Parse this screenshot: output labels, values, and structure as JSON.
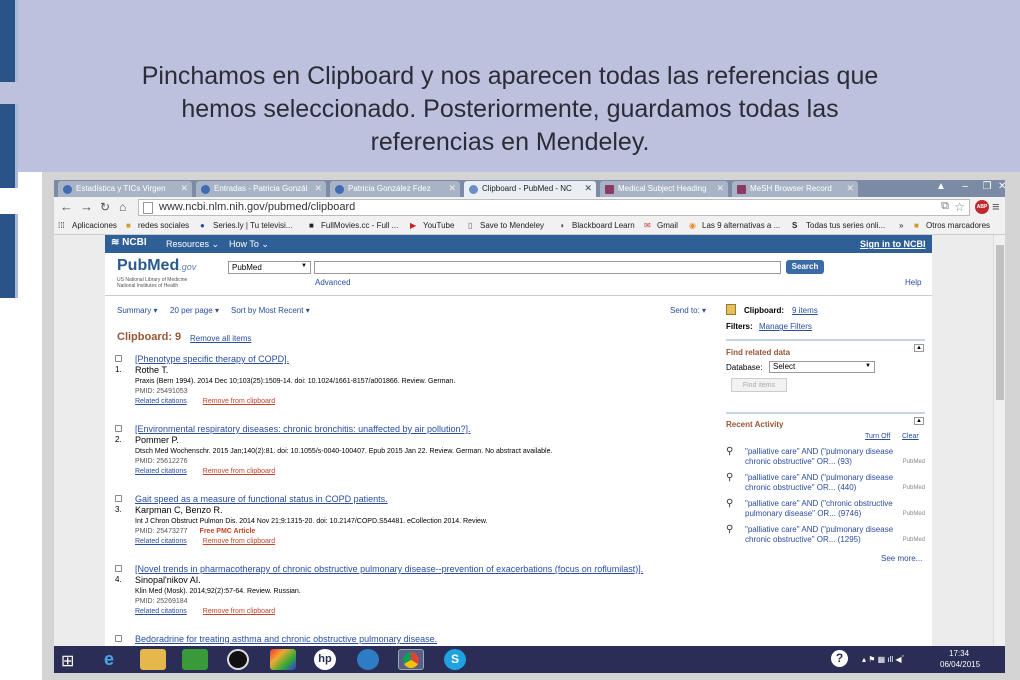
{
  "slide": {
    "caption_lines": [
      "Pinchamos en Clipboard y nos aparecen todas las referencias que",
      "hemos seleccionado. Posteriormente, guardamos todas las",
      "referencias en Mendeley."
    ]
  },
  "browser": {
    "tabs": [
      {
        "label": "Estadística y TICs Virgen",
        "active": false
      },
      {
        "label": "Entradas - Patricia Gonzál",
        "active": false
      },
      {
        "label": "Patricia González Fdez",
        "active": false
      },
      {
        "label": "Clipboard - PubMed - NC",
        "active": true
      },
      {
        "label": "Medical Subject Heading",
        "active": false
      },
      {
        "label": "MeSH Browser Record",
        "active": false
      }
    ],
    "url": "www.ncbi.nlm.nih.gov/pubmed/clipboard",
    "bookmarks": [
      "Aplicaciones",
      "redes sociales",
      "Series.ly | Tu televisi...",
      "FullMovies.cc - Full ...",
      "YouTube",
      "Save to Mendeley",
      "Blackboard Learn",
      "Gmail",
      "Las 9 alternativas a ...",
      "Todas tus series onli...",
      "Otros marcadores"
    ],
    "more_bookmarks": "»"
  },
  "ncbi_bar": {
    "logo": "NCBI",
    "resources": "Resources",
    "howto": "How To",
    "signin": "Sign in to NCBI"
  },
  "search": {
    "logo_main": "PubMed",
    "logo_gov": ".gov",
    "logo_sub": "US National Library of Medicine National Institutes of Health",
    "database": "PubMed",
    "query": "",
    "search_button": "Search",
    "advanced": "Advanced",
    "help": "Help"
  },
  "toolbar": {
    "summary": "Summary",
    "per_page": "20 per page",
    "sort": "Sort by Most Recent",
    "send_to": "Send to:"
  },
  "clipboard": {
    "heading": "Clipboard: 9",
    "remove_all": "Remove all items",
    "results": [
      {
        "num": "1.",
        "title": "[Phenotype specific therapy of COPD].",
        "authors": "Rothe T.",
        "citation": "Praxis (Bern 1994). 2014 Dec 10;103(25):1509-14. doi: 10.1024/1661-8157/a001866. Review. German.",
        "pmid": "PMID: 25491053",
        "free": "",
        "related": "Related citations",
        "remove": "Remove from clipboard"
      },
      {
        "num": "2.",
        "title": "[Environmental respiratory diseases: chronic bronchitis: unaffected by air pollution?].",
        "authors": "Pommer P.",
        "citation": "Dtsch Med Wochenschr. 2015 Jan;140(2):81. doi: 10.1055/s-0040-100407. Epub 2015 Jan 22. Review. German. No abstract available.",
        "pmid": "PMID: 25612276",
        "free": "",
        "related": "Related citations",
        "remove": "Remove from clipboard"
      },
      {
        "num": "3.",
        "title": "Gait speed as a measure of functional status in COPD patients.",
        "authors": "Karpman C, Benzo R.",
        "citation": "Int J Chron Obstruct Pulmon Dis. 2014 Nov 21;9:1315-20. doi: 10.2147/COPD.S54481. eCollection 2014. Review.",
        "pmid": "PMID: 25473277",
        "free": "Free PMC Article",
        "related": "Related citations",
        "remove": "Remove from clipboard"
      },
      {
        "num": "4.",
        "title": "[Novel trends in pharmacotherapy of chronic obstructive pulmonary disease--prevention of exacerbations (focus on roflumilast)].",
        "authors": "Sinopal'nikov AI.",
        "citation": "Klin Med (Mosk). 2014;92(2):57-64. Review. Russian.",
        "pmid": "PMID: 25269184",
        "free": "",
        "related": "Related citations",
        "remove": "Remove from clipboard"
      },
      {
        "num": "",
        "title": "Bedoradrine for treating asthma and chronic obstructive pulmonary disease.",
        "authors": "",
        "citation": "",
        "pmid": "",
        "free": "",
        "related": "",
        "remove": ""
      }
    ]
  },
  "sidebar": {
    "clipboard_label": "Clipboard:",
    "clipboard_items": "9 items",
    "filters_label": "Filters:",
    "manage_filters": "Manage Filters",
    "find_related": "Find related data",
    "database_label": "Database:",
    "database_value": "Select",
    "find_items": "Find items",
    "recent_activity": "Recent Activity",
    "turn_off": "Turn Off",
    "clear": "Clear",
    "activity": [
      {
        "text": "\"palliative care\" AND (\"pulmonary disease chronic obstructive\" OR... (93)",
        "src": "PubMed"
      },
      {
        "text": "\"palliative care\" AND (\"pulmonary disease chronic obstructive\" OR... (440)",
        "src": "PubMed"
      },
      {
        "text": "\"palliative care\" AND (\"chronic obstructive pulmonary disease\" OR... (9746)",
        "src": "PubMed"
      },
      {
        "text": "\"palliative care\" AND (\"pulmonary disease chronic obstructive\" OR... (1295)",
        "src": "PubMed"
      }
    ],
    "see_more": "See more..."
  },
  "taskbar": {
    "time": "17:34",
    "date": "06/04/2015",
    "help": "?"
  },
  "colors": {
    "slide_band": "#bcc2dd",
    "ncbi_bar": "#2f5f97",
    "link": "#2a4d9f",
    "accent_orange": "#c1442b",
    "heading_brown": "#985735",
    "taskbar": "#2a2d55"
  }
}
